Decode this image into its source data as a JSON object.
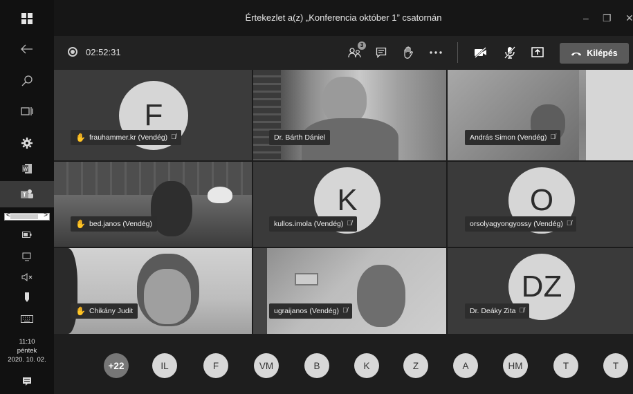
{
  "window": {
    "title": "Értekezlet a(z) „Konferencia október 1” csatornán",
    "minimize_glyph": "–",
    "restore_glyph": "❐",
    "close_glyph": "✕"
  },
  "toolbar": {
    "timer": "02:52:31",
    "participants_badge": "3",
    "leave_label": "Kilépés"
  },
  "tiles": [
    {
      "name": "frauhammer.kr (Vendég)",
      "initial": "F",
      "hand": true,
      "muted": true
    },
    {
      "name": "Dr. Bárth Dániel",
      "initial": "",
      "hand": false,
      "muted": false
    },
    {
      "name": "András Simon (Vendég)",
      "initial": "",
      "hand": false,
      "muted": true
    },
    {
      "name": "bed.janos (Vendég)",
      "initial": "",
      "hand": true,
      "muted": false
    },
    {
      "name": "kullos.imola (Vendég)",
      "initial": "K",
      "hand": false,
      "muted": true
    },
    {
      "name": "orsolyagyongyossy (Vendég)",
      "initial": "O",
      "hand": false,
      "muted": true
    },
    {
      "name": "Chikány Judit",
      "initial": "",
      "hand": true,
      "muted": false
    },
    {
      "name": "ugraijanos (Vendég)",
      "initial": "",
      "hand": false,
      "muted": true
    },
    {
      "name": "Dr. Deáky Zita",
      "initial": "DZ",
      "hand": false,
      "muted": true
    }
  ],
  "roster": [
    "+22",
    "IL",
    "F",
    "VM",
    "B",
    "K",
    "Z",
    "A",
    "HM",
    "T",
    "T"
  ],
  "clock": {
    "time": "11:10",
    "day": "péntek",
    "date": "2020. 10. 02."
  },
  "icons": {
    "hand": "raised-hand-icon",
    "mic_off": "mic-off-icon"
  }
}
